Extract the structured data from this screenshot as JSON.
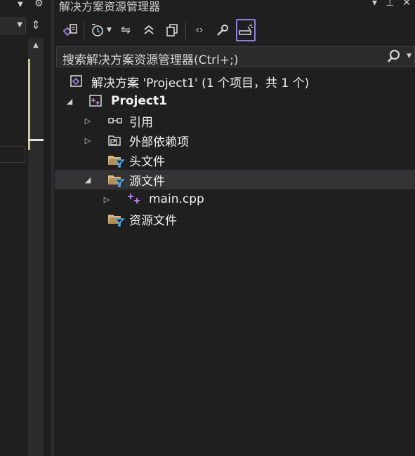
{
  "window": {
    "title": "解决方案资源管理器"
  },
  "search": {
    "placeholder": "搜索解决方案资源管理器(Ctrl+;)"
  },
  "tree": {
    "solution_label": "解决方案 'Project1' (1 个项目，共 1 个)",
    "project_label": "Project1",
    "references_label": "引用",
    "external_deps_label": "外部依赖项",
    "headers_label": "头文件",
    "sources_label": "源文件",
    "main_label": "main.cpp",
    "resources_label": "资源文件"
  },
  "colors": {
    "background": "#1f1f1f",
    "selection": "#333336",
    "active_button_border": "#8f7fdc",
    "folder": "#dcb67a",
    "filter": "#4fb3f6",
    "vs_purple": "#9a80e0",
    "cpp_plus": "#c586ff"
  },
  "icons": [
    "switch-views-icon",
    "history-icon",
    "sync-icon",
    "collapse-all-icon",
    "show-all-files-icon",
    "view-code-icon",
    "properties-icon",
    "preview-selected-icon",
    "search-icon"
  ]
}
